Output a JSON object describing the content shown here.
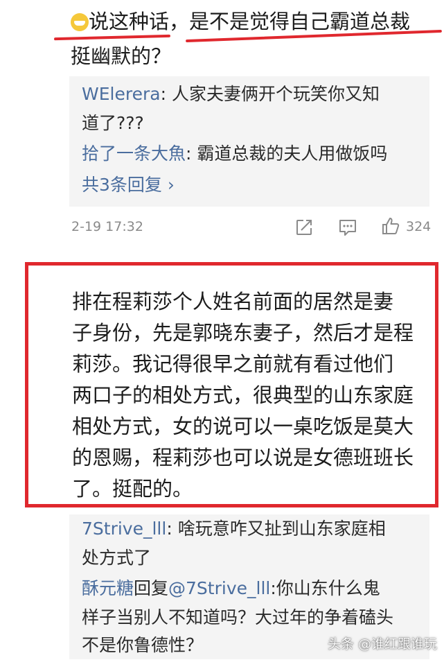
{
  "top_comment": {
    "emoji": "crying-face",
    "line1": "说这种话，是不是觉得自己霸道总裁",
    "line2": "挺幽默的？"
  },
  "reply_block_1": {
    "reply1": {
      "user": "WElerera",
      "sep": ": ",
      "line1": "人家夫妻俩开个玩笑你又知",
      "line2": "道了???"
    },
    "reply2": {
      "user": "拾了一条大魚",
      "sep": ": ",
      "text": "霸道总裁的夫人用做饭吗"
    },
    "more": "共3条回复 ›"
  },
  "meta": {
    "time": "2-19 17:32",
    "like_count": "324"
  },
  "highlighted_comment": {
    "lines": [
      "排在程莉莎个人姓名前面的居然是妻",
      "子身份，先是郭晓东妻子，然后才是程",
      "莉莎。我记得很早之前就有看过他们",
      "两口子的相处方式，很典型的山东家庭",
      "相处方式，女的说可以一桌吃饭是莫大",
      "的恩赐，程莉莎也可以说是女德班班长",
      "了。挺配的。"
    ]
  },
  "reply_block_2": {
    "reply1": {
      "user": "7Strive_lll",
      "sep": ": ",
      "line1": "啥玩意咋又扯到山东家庭相",
      "line2": "处方式了"
    },
    "reply2": {
      "user": "酥元糖",
      "mid": "回复",
      "mention": "@7Strive_lll",
      "sep": ":",
      "line1": "你山东什么鬼",
      "line2": "样子当别人不知道吗？大过年的争着磕头",
      "line3": "不是你鲁德性？"
    }
  },
  "watermark": "头条 @谁红跟谁玩",
  "colors": {
    "accent_red": "#e0282e",
    "username_blue": "#4a6d9e",
    "reply_bg": "#f4f4f4"
  }
}
